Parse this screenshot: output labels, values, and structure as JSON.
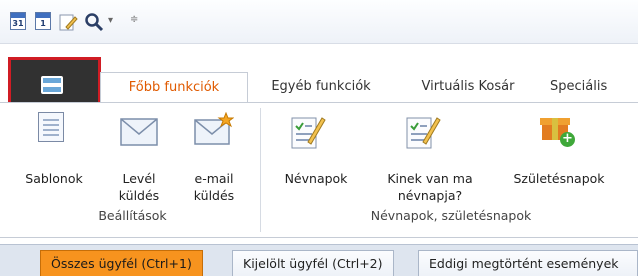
{
  "quick_access": {
    "items": [
      {
        "icon": "calendar-31-icon",
        "text": "31"
      },
      {
        "icon": "calendar-1-icon",
        "text": "1"
      },
      {
        "icon": "notepad-icon"
      },
      {
        "icon": "search-icon"
      },
      {
        "icon": "dropdown-arrow-icon"
      },
      {
        "icon": "customize-icon"
      }
    ]
  },
  "ribbon": {
    "file_button": {
      "icon": "application-menu-icon"
    },
    "tabs": [
      {
        "label": "Főbb funkciók",
        "active": true
      },
      {
        "label": "Egyéb funkciók",
        "active": false
      },
      {
        "label": "Virtuális Kosár",
        "active": false
      },
      {
        "label": "Speciális",
        "active": false
      }
    ],
    "groups": [
      {
        "label": "Beállítások",
        "buttons": [
          {
            "label_line1": "Sablonok",
            "label_line2": "",
            "icon": "template-document-icon"
          },
          {
            "label_line1": "Levél",
            "label_line2": "küldés",
            "icon": "envelope-icon"
          },
          {
            "label_line1": "e-mail",
            "label_line2": "küldés",
            "icon": "email-star-icon"
          }
        ]
      },
      {
        "label": "Névnapok, születésnapok",
        "buttons": [
          {
            "label_line1": "Névnapok",
            "label_line2": "",
            "icon": "checklist-pencil-icon"
          },
          {
            "label_line1": "Kinek van ma",
            "label_line2": "névnapja?",
            "icon": "checklist-pencil-icon"
          },
          {
            "label_line1": "Születésnapok",
            "label_line2": "",
            "icon": "gift-add-icon"
          }
        ]
      }
    ]
  },
  "document_tabs": [
    {
      "label": "Összes ügyfél (Ctrl+1)",
      "active": true
    },
    {
      "label": "Kijelölt ügyfél (Ctrl+2)",
      "active": false
    },
    {
      "label": "Eddigi megtörtént események",
      "active": false
    }
  ],
  "colors": {
    "accent_orange": "#f7931e",
    "active_tab_text": "#e05a00",
    "file_button_bg": "#313131",
    "highlight_red": "#d01c24"
  }
}
